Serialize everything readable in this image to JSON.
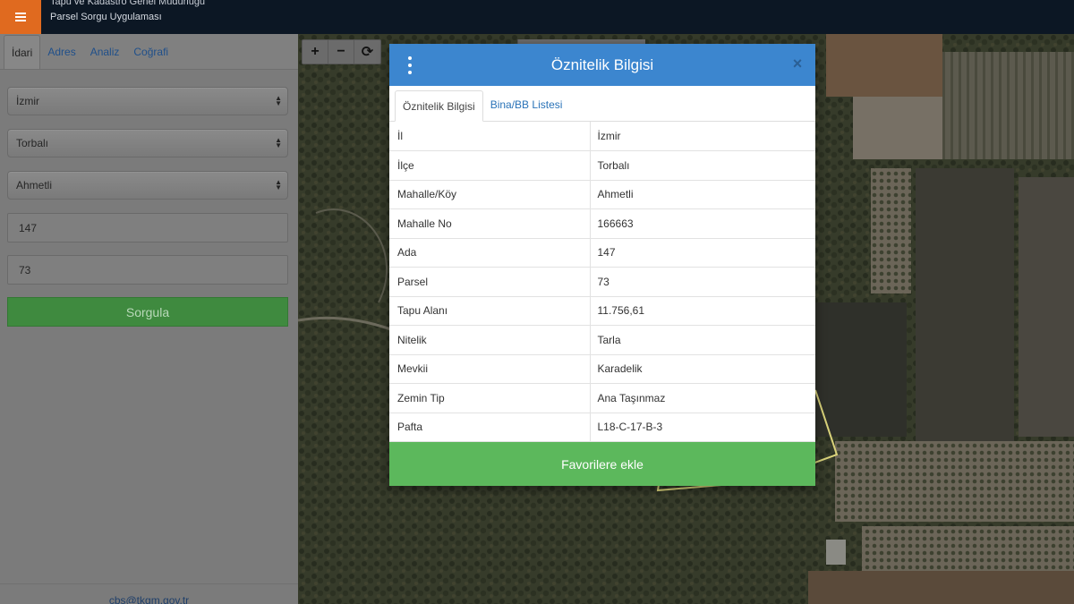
{
  "header": {
    "title_line1": "Tapu ve Kadastro Genel Müdürlüğü",
    "title_line2": "Parsel Sorgu Uygulaması",
    "menu_icon": "hamburger-icon",
    "accent": "#e06a1f",
    "background": "#0c1724"
  },
  "sidebar": {
    "tabs": [
      {
        "label": "İdari",
        "active": true
      },
      {
        "label": "Adres",
        "active": false
      },
      {
        "label": "Analiz",
        "active": false
      },
      {
        "label": "Coğrafi",
        "active": false
      }
    ],
    "province_select": "İzmir",
    "district_select": "Torbalı",
    "neighborhood_select": "Ahmetli",
    "ada_value": "147",
    "parsel_value": "73",
    "query_button": "Sorgula",
    "footer_email": "cbs@tkgm.gov.tr"
  },
  "map": {
    "tools": [
      {
        "icon": "plus-icon",
        "glyph": "+"
      },
      {
        "icon": "minus-icon",
        "glyph": "−"
      },
      {
        "icon": "refresh-icon",
        "glyph": "⟳"
      }
    ]
  },
  "modal": {
    "title": "Öznitelik Bilgisi",
    "tabs": [
      {
        "label": "Öznitelik Bilgisi",
        "active": true
      },
      {
        "label": "Bina/BB Listesi",
        "active": false
      }
    ],
    "rows": [
      {
        "key": "İl",
        "value": "İzmir"
      },
      {
        "key": "İlçe",
        "value": "Torbalı"
      },
      {
        "key": "Mahalle/Köy",
        "value": "Ahmetli"
      },
      {
        "key": "Mahalle No",
        "value": "166663"
      },
      {
        "key": "Ada",
        "value": "147"
      },
      {
        "key": "Parsel",
        "value": "73"
      },
      {
        "key": "Tapu Alanı",
        "value": "11.756,61"
      },
      {
        "key": "Nitelik",
        "value": "Tarla"
      },
      {
        "key": "Mevkii",
        "value": "Karadelik"
      },
      {
        "key": "Zemin Tip",
        "value": "Ana Taşınmaz"
      },
      {
        "key": "Pafta",
        "value": "L18-C-17-B-3"
      }
    ],
    "favorite_button": "Favorilere ekle",
    "header_color": "#3c86cf",
    "button_color": "#5cb85c"
  }
}
